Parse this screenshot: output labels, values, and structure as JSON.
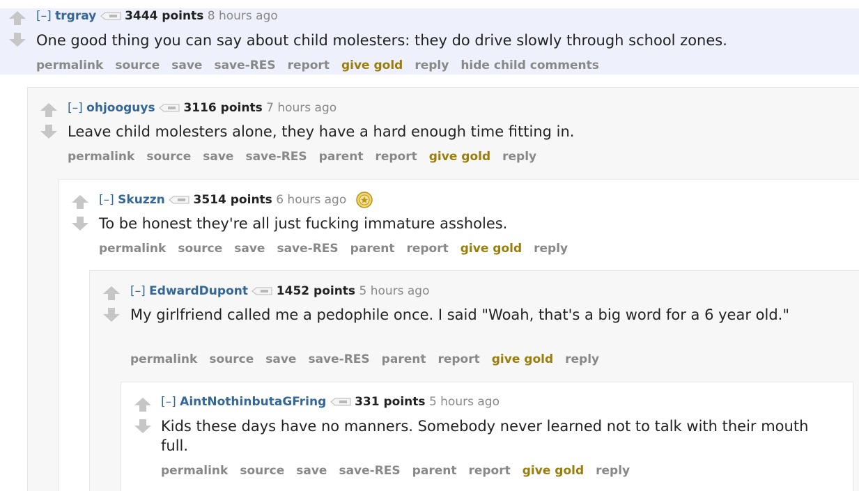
{
  "colors": {
    "author": "#336699",
    "gold": "#9a7d0a",
    "muted": "#888888",
    "highlight_bg": "#eef1fb"
  },
  "comments": [
    {
      "collapse": "[–]",
      "author": "trgray",
      "score": "3444 points",
      "time": "8 hours ago",
      "body": "One good thing you can say about child molesters: they do drive slowly through school zones.",
      "buttons": [
        "permalink",
        "source",
        "save",
        "save-RES",
        "report",
        "give gold",
        "reply",
        "hide child comments"
      ]
    },
    {
      "collapse": "[–]",
      "author": "ohjooguys",
      "score": "3116 points",
      "time": "7 hours ago",
      "body": "Leave child molesters alone, they have a hard enough time fitting in.",
      "buttons": [
        "permalink",
        "source",
        "save",
        "save-RES",
        "parent",
        "report",
        "give gold",
        "reply"
      ]
    },
    {
      "collapse": "[–]",
      "author": "Skuzzn",
      "score": "3514 points",
      "time": "6 hours ago",
      "gilded_icon": "gold-star-icon",
      "body": "To be honest they're all just fucking immature assholes.",
      "buttons": [
        "permalink",
        "source",
        "save",
        "save-RES",
        "parent",
        "report",
        "give gold",
        "reply"
      ]
    },
    {
      "collapse": "[–]",
      "author": "EdwardDupont",
      "score": "1452 points",
      "time": "5 hours ago",
      "body": "My girlfriend called me a pedophile once. I said \"Woah, that's a big word for a 6 year old.\"",
      "buttons": [
        "permalink",
        "source",
        "save",
        "save-RES",
        "parent",
        "report",
        "give gold",
        "reply"
      ]
    },
    {
      "collapse": "[–]",
      "author": "AintNothinbutaGFring",
      "score": "331 points",
      "time": "5 hours ago",
      "body": "Kids these days have no manners. Somebody never learned not to talk with their mouth full.",
      "buttons": [
        "permalink",
        "source",
        "save",
        "save-RES",
        "parent",
        "report",
        "give gold",
        "reply"
      ]
    }
  ]
}
